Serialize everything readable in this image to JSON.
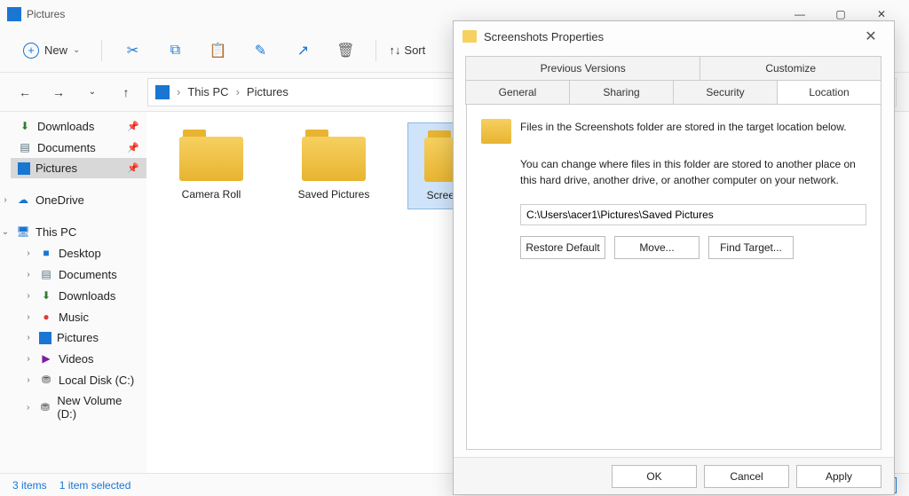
{
  "titlebar": {
    "title": "Pictures"
  },
  "toolbar": {
    "new_label": "New",
    "sort_label": "Sort"
  },
  "breadcrumb": {
    "parts": [
      "This PC",
      "Pictures"
    ]
  },
  "sidebar": {
    "quick": [
      {
        "label": "Downloads",
        "icon": "download",
        "pinned": true
      },
      {
        "label": "Documents",
        "icon": "document",
        "pinned": true
      },
      {
        "label": "Pictures",
        "icon": "picture",
        "pinned": true,
        "selected": true
      }
    ],
    "onedrive": {
      "label": "OneDrive"
    },
    "thispc": {
      "label": "This PC",
      "children": [
        {
          "label": "Desktop",
          "icon": "desktop"
        },
        {
          "label": "Documents",
          "icon": "document"
        },
        {
          "label": "Downloads",
          "icon": "download"
        },
        {
          "label": "Music",
          "icon": "music"
        },
        {
          "label": "Pictures",
          "icon": "picture"
        },
        {
          "label": "Videos",
          "icon": "video"
        },
        {
          "label": "Local Disk (C:)",
          "icon": "disk"
        },
        {
          "label": "New Volume (D:)",
          "icon": "disk"
        }
      ]
    }
  },
  "folders": [
    {
      "label": "Camera Roll"
    },
    {
      "label": "Saved Pictures"
    },
    {
      "label": "Screenshots",
      "selected": true
    }
  ],
  "statusbar": {
    "count": "3 items",
    "selection": "1 item selected"
  },
  "dialog": {
    "title": "Screenshots Properties",
    "tabs_row1": [
      "Previous Versions",
      "Customize"
    ],
    "tabs_row2": [
      "General",
      "Sharing",
      "Security",
      "Location"
    ],
    "active_tab": "Location",
    "desc1": "Files in the Screenshots folder are stored in the target location below.",
    "desc2": "You can change where files in this folder are stored to another place on this hard drive, another drive, or another computer on your network.",
    "path": "C:\\Users\\acer1\\Pictures\\Saved Pictures",
    "restore": "Restore Default",
    "move": "Move...",
    "find": "Find Target...",
    "ok": "OK",
    "cancel": "Cancel",
    "apply": "Apply"
  }
}
